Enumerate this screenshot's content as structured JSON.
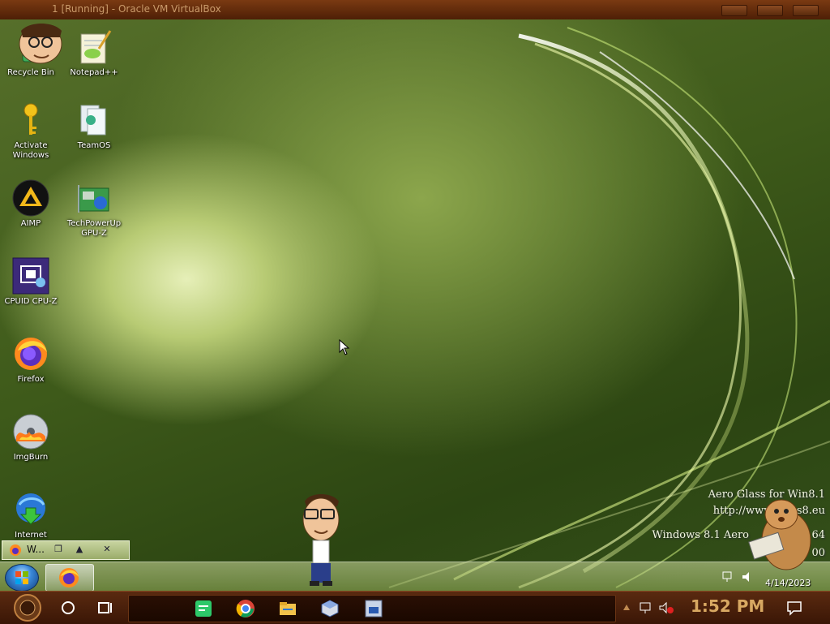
{
  "host_window": {
    "title": "1 [Running] - Oracle VM VirtualBox"
  },
  "desktop_icons": [
    {
      "label": "Recycle Bin",
      "icon": "recycle-bin-icon"
    },
    {
      "label": "Notepad++",
      "icon": "notepad-plus-plus-icon"
    },
    {
      "label": "Activate Windows",
      "icon": "key-icon"
    },
    {
      "label": "TeamOS",
      "icon": "teamos-icon"
    },
    {
      "label": "AIMP",
      "icon": "aimp-icon"
    },
    {
      "label": "TechPowerUp GPU-Z",
      "icon": "gpu-z-icon"
    },
    {
      "label": "CPUID CPU-Z",
      "icon": "cpu-z-icon"
    },
    {
      "label": "Firefox",
      "icon": "firefox-icon"
    },
    {
      "label": "ImgBurn",
      "icon": "imgburn-icon"
    },
    {
      "label": "Internet Downl...",
      "icon": "internet-download-manager-icon"
    }
  ],
  "watermark": {
    "line1": "Aero Glass for Win8.1",
    "line2": "http://www.glass8.eu",
    "line3": "Windows 8.1 Aero",
    "line3_suffix": "64",
    "line4_suffix": "00"
  },
  "thumbnail_preview": {
    "title": "W...",
    "buttons": [
      "restore",
      "maximize",
      "close"
    ]
  },
  "upper_taskbar": {
    "date": "4/14/2023"
  },
  "lower_taskbar": {
    "clock": "1:52 PM",
    "pinned": [
      "cortana-circle-icon",
      "task-view-icon",
      "sticky-notes-icon",
      "chrome-icon",
      "file-explorer-icon",
      "virtualbox-icon",
      "windows-81-icon"
    ],
    "tray": [
      "network-icon",
      "volume-muted-icon",
      "notification-icon"
    ]
  },
  "colors": {
    "host_title": "#5e2a0a",
    "desktop_green": "#3e5a1a",
    "clock_text": "#d8a862",
    "lower_taskbar": "#3a1606"
  }
}
